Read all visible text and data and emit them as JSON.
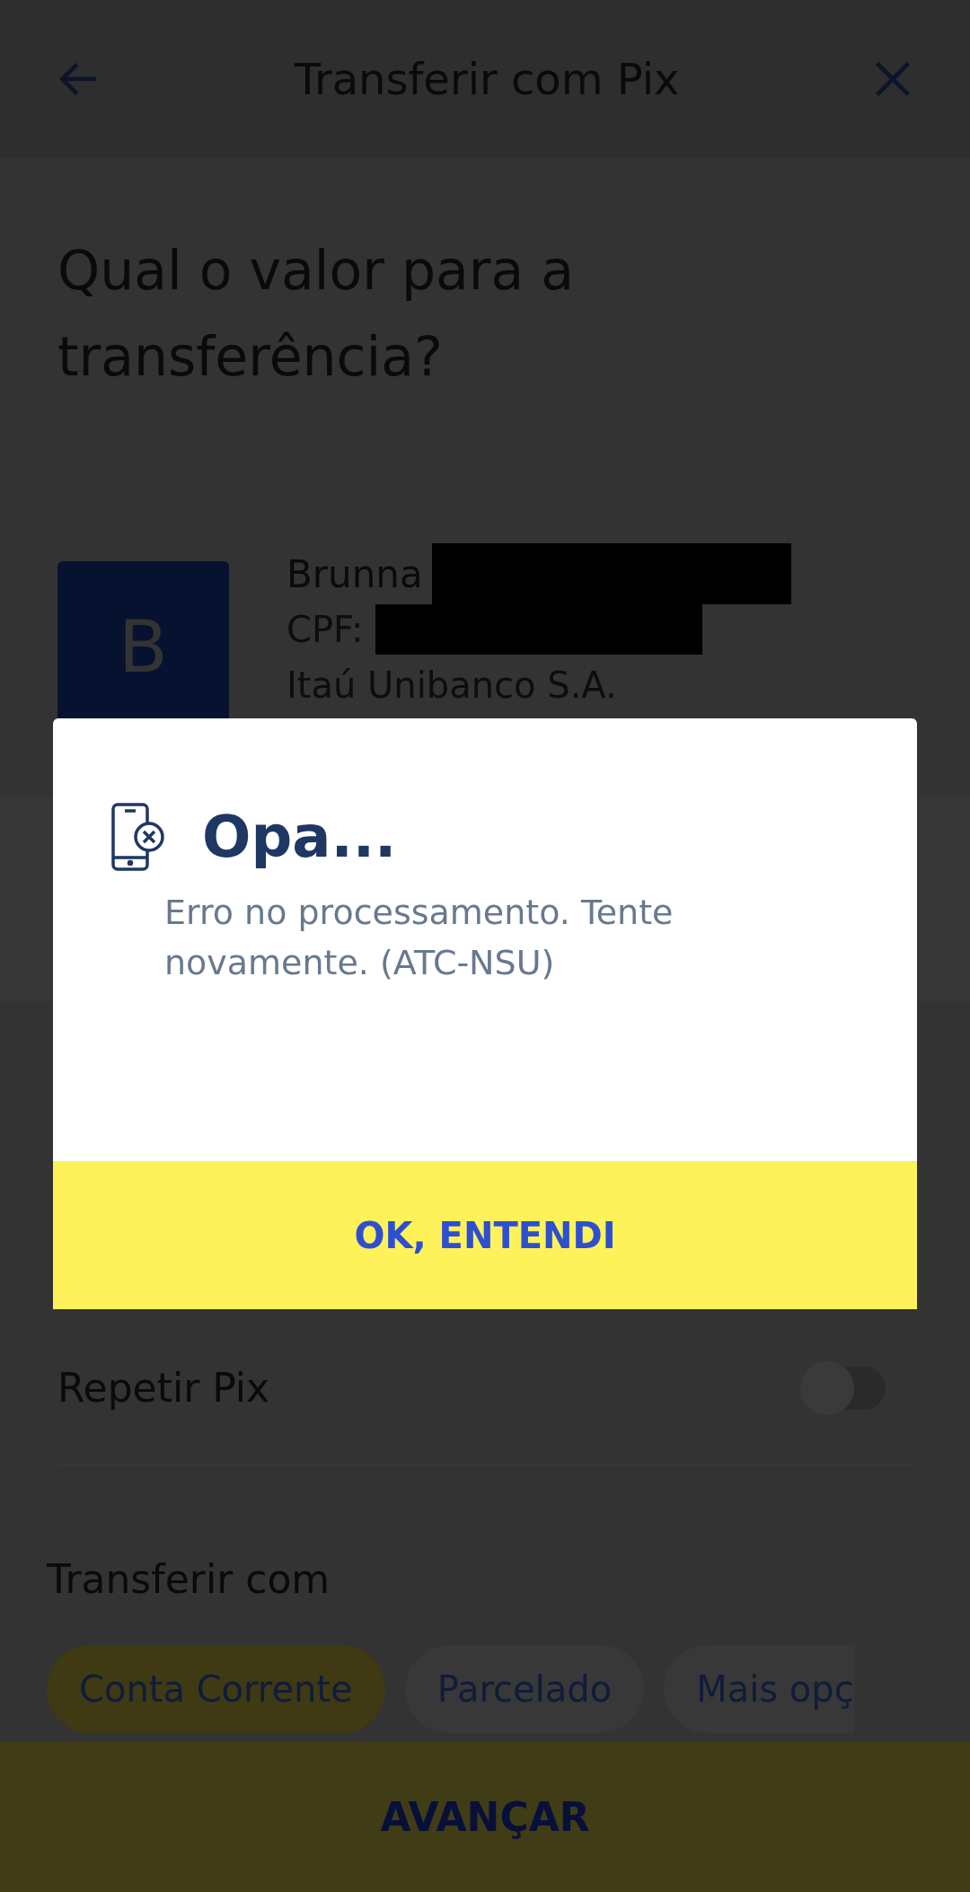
{
  "header": {
    "title": "Transferir com Pix"
  },
  "heading": "Qual o valor para a transferência?",
  "recipient": {
    "initial": "B",
    "name": "Brunna",
    "cpf_label": "CPF:",
    "bank": "Itaú Unibanco S.A."
  },
  "repeat": {
    "label": "Repetir Pix",
    "on": false
  },
  "transfer_with": {
    "title": "Transferir com",
    "options": [
      {
        "label": "Conta Corrente",
        "selected": true
      },
      {
        "label": "Parcelado",
        "selected": false
      },
      {
        "label": "Mais opç",
        "selected": false
      }
    ]
  },
  "primary_button": "AVANÇAR",
  "dialog": {
    "title": "Opa...",
    "message": "Erro no processamento. Tente novamente. (ATC-NSU)",
    "button": "OK, ENTENDI"
  }
}
